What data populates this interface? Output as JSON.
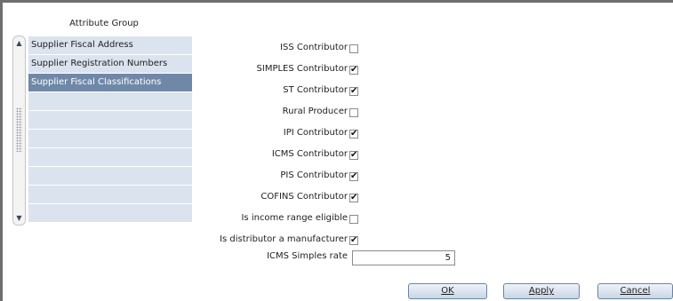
{
  "attribute_group": {
    "title": "Attribute Group",
    "items": [
      {
        "label": "Supplier Fiscal Address",
        "selected": false
      },
      {
        "label": "Supplier Registration Numbers",
        "selected": false
      },
      {
        "label": "Supplier Fiscal Classifications",
        "selected": true
      },
      {
        "label": ""
      },
      {
        "label": ""
      },
      {
        "label": ""
      },
      {
        "label": ""
      },
      {
        "label": ""
      },
      {
        "label": ""
      },
      {
        "label": ""
      }
    ]
  },
  "form": {
    "fields": [
      {
        "label": "ISS Contributor",
        "checked": false
      },
      {
        "label": "SIMPLES Contributor",
        "checked": true
      },
      {
        "label": "ST Contributor",
        "checked": true
      },
      {
        "label": "Rural Producer",
        "checked": false
      },
      {
        "label": "IPI Contributor",
        "checked": true
      },
      {
        "label": "ICMS Contributor",
        "checked": true
      },
      {
        "label": "PIS Contributor",
        "checked": true
      },
      {
        "label": "COFINS Contributor",
        "checked": true
      },
      {
        "label": "Is income range eligible",
        "checked": false
      },
      {
        "label": "Is distributor a manufacturer",
        "checked": true
      }
    ],
    "icms_simples_rate": {
      "label": "ICMS Simples rate",
      "value": "5"
    }
  },
  "buttons": {
    "ok": "OK",
    "apply": "Apply",
    "cancel": "Cancel"
  }
}
